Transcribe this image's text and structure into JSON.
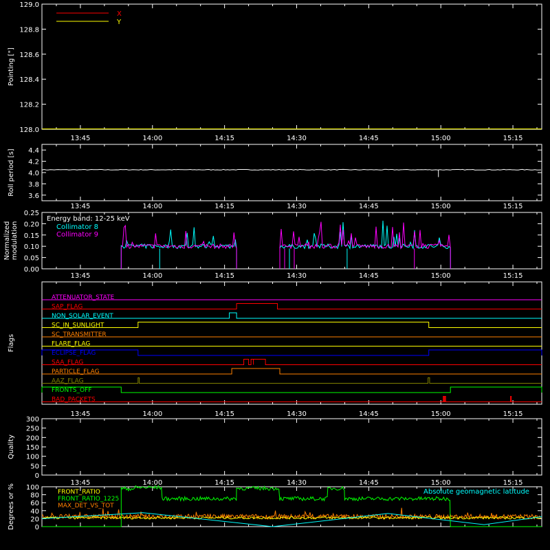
{
  "x_tick_labels": [
    "13:45",
    "14:00",
    "14:15",
    "14:30",
    "14:45",
    "15:00",
    "15:15"
  ],
  "time_range": [
    "13:37",
    "15:21"
  ],
  "colors": {
    "background": "#000000",
    "axes": "#ffffff",
    "x": "#ff0000",
    "y": "#ffff00",
    "cyan": "#00ffff",
    "magenta": "#ff00ff",
    "green": "#00ff00",
    "orange": "#ff8000",
    "white": "#ffffff"
  },
  "chart_data": [
    {
      "type": "line",
      "ylabel": "Pointing [\"]",
      "ylim": [
        128.0,
        129.0
      ],
      "y_ticks": [
        "128.0",
        "128.2",
        "128.4",
        "128.6",
        "128.8",
        "129.0"
      ],
      "y_tick_values": [
        128.0,
        128.2,
        128.4,
        128.6,
        128.8,
        129.0
      ],
      "legend": [
        {
          "name": "X",
          "color": "#ff0000"
        },
        {
          "name": "Y",
          "color": "#ffff00"
        }
      ],
      "legend_position": "top-left",
      "series": [
        {
          "name": "X",
          "color": "#ff0000",
          "value": 128.0
        },
        {
          "name": "Y",
          "color": "#ffff00",
          "value": 128.0
        }
      ]
    },
    {
      "type": "line",
      "ylabel": "Roll period [s]",
      "ylim": [
        3.5,
        4.5
      ],
      "y_ticks": [
        "3.6",
        "3.8",
        "4.0",
        "4.2",
        "4.4"
      ],
      "y_tick_values": [
        3.6,
        3.8,
        4.0,
        4.2,
        4.4
      ],
      "series": [
        {
          "name": "roll period",
          "color": "#ffffff",
          "baseline": 4.05,
          "dips": [
            {
              "time": "14:59:30",
              "value": 3.92
            }
          ]
        }
      ]
    },
    {
      "type": "line",
      "ylabel": "Normalized modulation",
      "ylim": [
        0.0,
        0.25
      ],
      "y_ticks": [
        "0.00",
        "0.05",
        "0.10",
        "0.15",
        "0.20",
        "0.25"
      ],
      "y_tick_values": [
        0.0,
        0.05,
        0.1,
        0.15,
        0.2,
        0.25
      ],
      "annotation": "Energy band: 12-25 keV",
      "legend": [
        {
          "name": "Collimator 8",
          "color": "#00ffff"
        },
        {
          "name": "Collimator 9",
          "color": "#ff00ff"
        }
      ],
      "legend_position": "top-left",
      "segments": [
        {
          "start": "13:53:30",
          "end": "14:17:30",
          "level": 0.09
        },
        {
          "start": "14:26:30",
          "end": "15:02:00",
          "level": 0.09
        }
      ],
      "dropouts": [
        "14:01:30",
        "14:27:30",
        "14:28:30",
        "14:29:30",
        "14:40:30",
        "14:54:30"
      ]
    },
    {
      "type": "line",
      "ylabel": "Flags",
      "flags": [
        {
          "name": "ATTENUATOR_STATE",
          "color": "#ff00ff",
          "high_intervals": []
        },
        {
          "name": "SAP_FLAG",
          "color": "#ff0000",
          "high_intervals": [
            [
              "14:17:30",
              "14:26:00"
            ]
          ]
        },
        {
          "name": "NON_SOLAR_EVENT",
          "color": "#00ffff",
          "high_intervals": [
            [
              "14:16:00",
              "14:17:30"
            ]
          ]
        },
        {
          "name": "SC_IN_SUNLIGHT",
          "color": "#ffff00",
          "high_intervals": [
            [
              "13:57:00",
              "14:57:30"
            ]
          ]
        },
        {
          "name": "SC_TRANSMITTER",
          "color": "#ff8000",
          "high_intervals": []
        },
        {
          "name": "FLARE_FLAG",
          "color": "#ffff00",
          "high_intervals": []
        },
        {
          "name": "ECLIPSE_FLAG",
          "color": "#0000ff",
          "high_intervals": [
            [
              "13:37:00",
              "13:57:00"
            ],
            [
              "14:57:30",
              "15:21:00"
            ]
          ]
        },
        {
          "name": "SAA_FLAG",
          "color": "#ff0000",
          "high_intervals": [
            [
              "14:19:00",
              "14:20:00"
            ],
            [
              "14:20:30",
              "14:21:00"
            ],
            [
              "14:21:00",
              "14:23:30"
            ]
          ]
        },
        {
          "name": "PARTICLE_FLAG",
          "color": "#ff8000",
          "high_intervals": [
            [
              "14:16:30",
              "14:26:30"
            ]
          ]
        },
        {
          "name": "AAZ_FLAG",
          "color": "#808000",
          "high_intervals": [
            [
              "13:57:00",
              "13:57:15"
            ],
            [
              "14:57:20",
              "14:57:40"
            ]
          ]
        },
        {
          "name": "FRONTS_OFF",
          "color": "#00ff00",
          "high_intervals": [
            [
              "13:37:00",
              "13:53:30"
            ],
            [
              "15:02:00",
              "15:21:00"
            ]
          ]
        },
        {
          "name": "BAD_PACKETS",
          "color": "#ff0000",
          "high_intervals": [
            [
              "15:00:30",
              "15:00:40"
            ],
            [
              "15:00:50",
              "15:01:00"
            ],
            [
              "15:14:30",
              "15:14:40"
            ]
          ]
        }
      ]
    },
    {
      "type": "line",
      "ylabel": "Quality",
      "ylim": [
        0,
        300
      ],
      "y_ticks": [
        "0",
        "50",
        "100",
        "150",
        "200",
        "250",
        "300"
      ],
      "y_tick_values": [
        0,
        50,
        100,
        150,
        200,
        250,
        300
      ],
      "series": []
    },
    {
      "type": "line",
      "ylabel": "Degrees or %",
      "ylim": [
        0,
        100
      ],
      "y_ticks": [
        "0",
        "20",
        "40",
        "60",
        "80",
        "100"
      ],
      "y_tick_values": [
        0,
        20,
        40,
        60,
        80,
        100
      ],
      "legend": [
        {
          "name": "FRONT_RATIO",
          "color": "#ffff00"
        },
        {
          "name": "FRONT_RATIO_1225",
          "color": "#00ff00"
        },
        {
          "name": "MAX_DET_VS_TOT",
          "color": "#ff8000"
        }
      ],
      "legend_position": "top-left",
      "annotation": "Absolute geomagnetic latitude",
      "annotation_color": "#00ffff",
      "series": [
        {
          "name": "FRONT_RATIO_1225",
          "color": "#00ff00",
          "segments": [
            {
              "start": "13:53:30",
              "end": "13:56:30",
              "level": 95,
              "drop_at": "13:53:30"
            },
            {
              "start": "13:56:30",
              "end": "14:02:00",
              "level": 98
            },
            {
              "start": "14:02:00",
              "end": "14:17:30",
              "level": 70
            },
            {
              "start": "14:17:30",
              "end": "14:26:30",
              "level": 96
            },
            {
              "start": "14:26:30",
              "end": "14:36:30",
              "level": 70
            },
            {
              "start": "14:36:30",
              "end": "14:40:00",
              "level": 96
            },
            {
              "start": "14:40:00",
              "end": "15:02:00",
              "level": 70
            }
          ]
        },
        {
          "name": "MAX_DET_VS_TOT",
          "color": "#ff8000",
          "level": 25
        },
        {
          "name": "FRONT_RATIO",
          "color": "#ffff00",
          "level": 22
        },
        {
          "name": "Absolute geomagnetic latitude",
          "color": "#00ffff",
          "points": [
            [
              "13:37",
              20
            ],
            [
              "13:58",
              35
            ],
            [
              "14:25",
              0
            ],
            [
              "14:49",
              33
            ],
            [
              "15:09",
              5
            ],
            [
              "15:21",
              25
            ]
          ]
        }
      ]
    }
  ]
}
